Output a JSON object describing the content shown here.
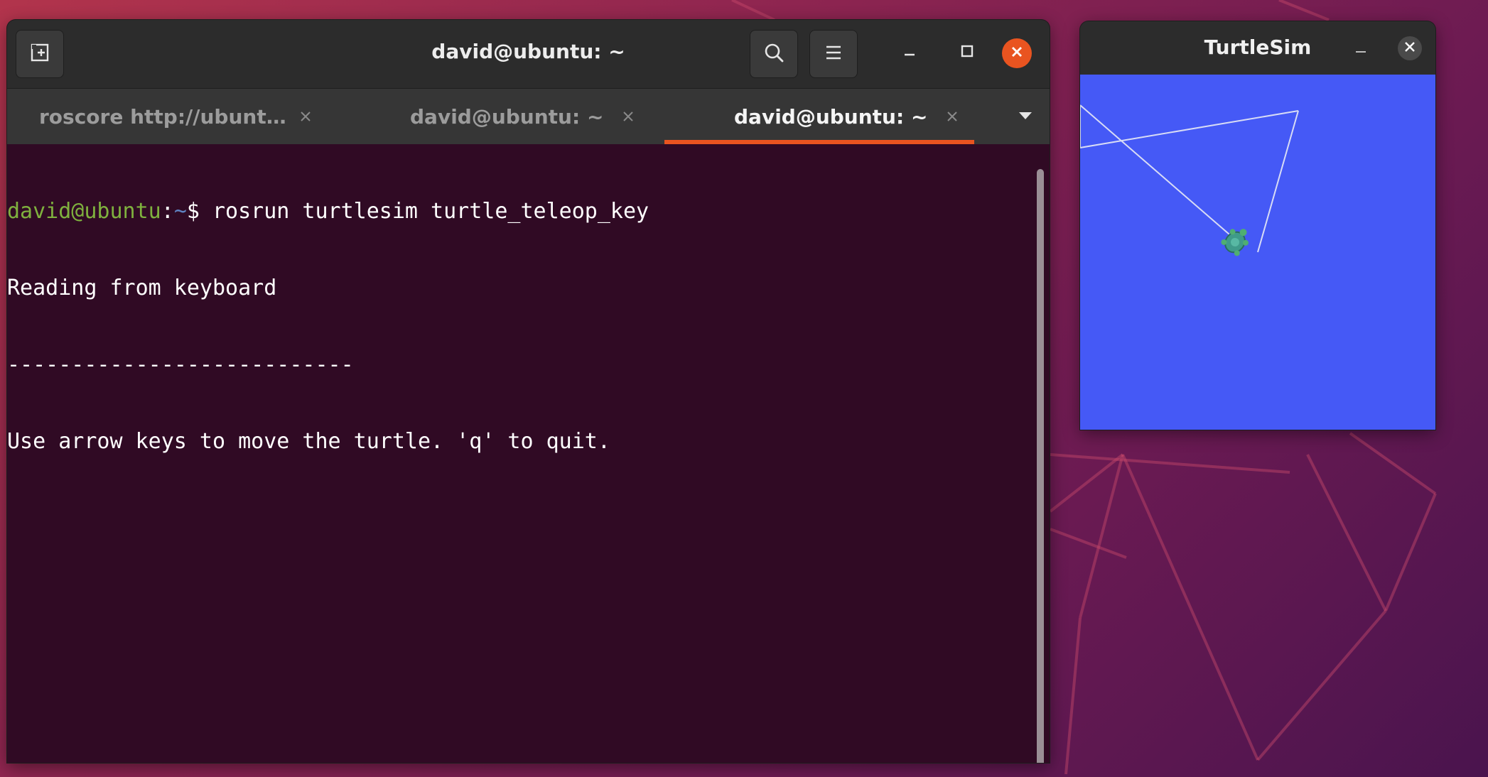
{
  "desktop": {
    "background_colors": [
      "#b2344c",
      "#8e2550",
      "#6a1a52",
      "#4a144e"
    ]
  },
  "terminal": {
    "title": "david@ubuntu: ~",
    "new_tab_icon": "new-tab-icon",
    "search_icon": "search-icon",
    "menu_icon": "hamburger-menu-icon",
    "close_color": "#e95420",
    "tabs": [
      {
        "label": "roscore http://ubunt…",
        "active": false
      },
      {
        "label": "david@ubuntu: ~",
        "active": false
      },
      {
        "label": "david@ubuntu: ~",
        "active": true
      }
    ],
    "lines": {
      "user": "david@ubuntu",
      "colon": ":",
      "path": "~",
      "prompt_rest": "$ rosrun turtlesim turtle_teleop_key",
      "line2": "Reading from keyboard",
      "line3": "---------------------------",
      "line4": "Use arrow keys to move the turtle. 'q' to quit."
    }
  },
  "turtlesim": {
    "title": "TurtleSim",
    "canvas_color": "#4559f6",
    "trail_color": "#d8dcf5"
  }
}
